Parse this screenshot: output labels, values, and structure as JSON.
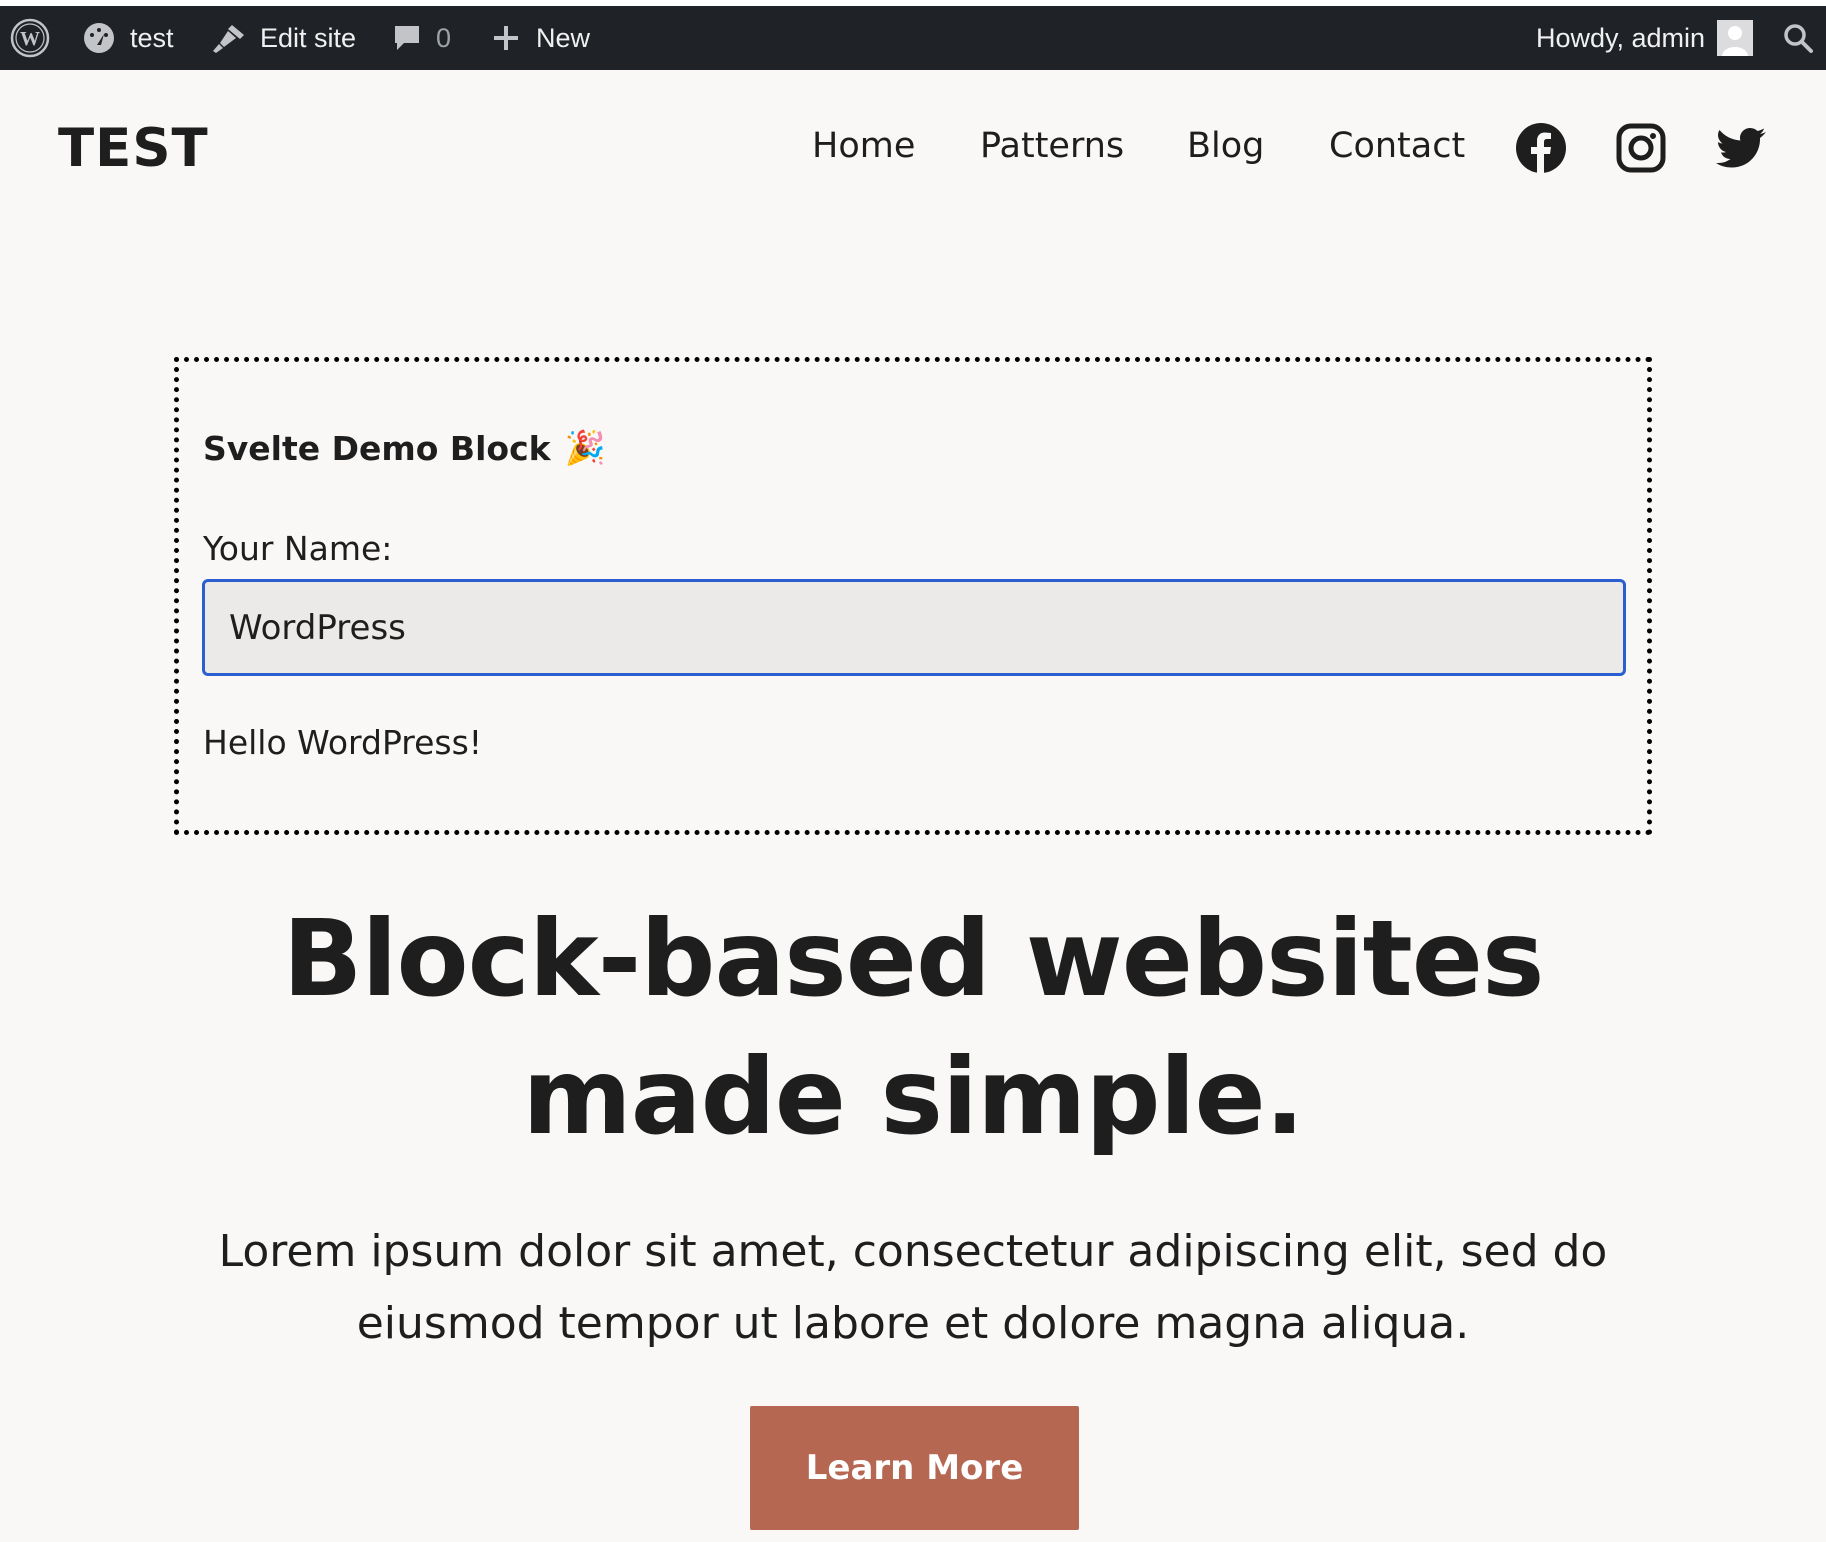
{
  "admin_bar": {
    "wordpress_icon": "wordpress-logo-icon",
    "site_name": "test",
    "site_icon": "dashboard-gauge-icon",
    "edit_site": "Edit site",
    "edit_icon": "paintbrush-icon",
    "comments_count": "0",
    "comments_icon": "comment-bubble-icon",
    "new_label": "New",
    "new_icon": "plus-icon",
    "greeting": "Howdy, admin",
    "avatar_icon": "user-avatar-icon",
    "search_icon": "search-icon"
  },
  "site": {
    "title": "TEST",
    "nav": [
      "Home",
      "Patterns",
      "Blog",
      "Contact"
    ],
    "social_icons": [
      "facebook-icon",
      "instagram-icon",
      "twitter-icon"
    ]
  },
  "demo_block": {
    "title": "Svelte Demo Block",
    "title_emoji": "🎉",
    "label": "Your Name:",
    "input_value": "WordPress",
    "greeting": "Hello WordPress!"
  },
  "hero": {
    "heading_line1": "Block-based websites",
    "heading_line2": "made simple.",
    "text_line1": "Lorem ipsum dolor sit amet, consectetur adipiscing elit, sed do",
    "text_line2": "eiusmod tempor ut labore et dolore magna aliqua.",
    "button": "Learn More"
  },
  "colors": {
    "admin_bar_bg": "#1f2327",
    "page_bg": "#f9f8f6",
    "input_focus_border": "#2b5fcf",
    "button_bg": "#b66752",
    "text": "#1e1e1e"
  }
}
